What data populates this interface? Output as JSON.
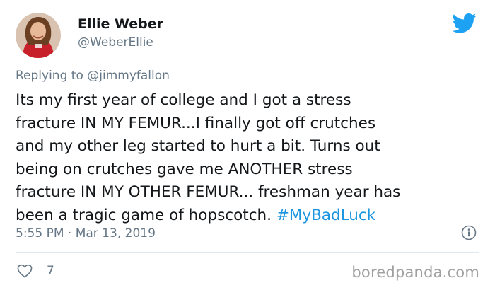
{
  "tweet": {
    "display_name": "Ellie Weber",
    "handle": "@WeberEllie",
    "reply_prefix": "Replying to ",
    "reply_to": "@jimmyfallon",
    "text": "Its my first year of college and I got a stress\nfracture IN MY FEMUR...I finally got off crutches\nand my other leg started to hurt a bit. Turns out\nbeing on crutches gave me ANOTHER stress\nfracture IN MY OTHER FEMUR... freshman year has\nbeen a tragic game of hopscotch. ",
    "hashtag": "#MyBadLuck",
    "timestamp": "5:55 PM · Mar 13, 2019",
    "like_count": "7"
  },
  "icons": {
    "brand": "twitter-bird-icon",
    "info": "info-icon",
    "like": "heart-icon"
  },
  "colors": {
    "twitter_blue": "#1da1f2",
    "hashtag": "#1b95e0",
    "secondary_text": "#657786"
  },
  "watermark": "boredpanda.com"
}
